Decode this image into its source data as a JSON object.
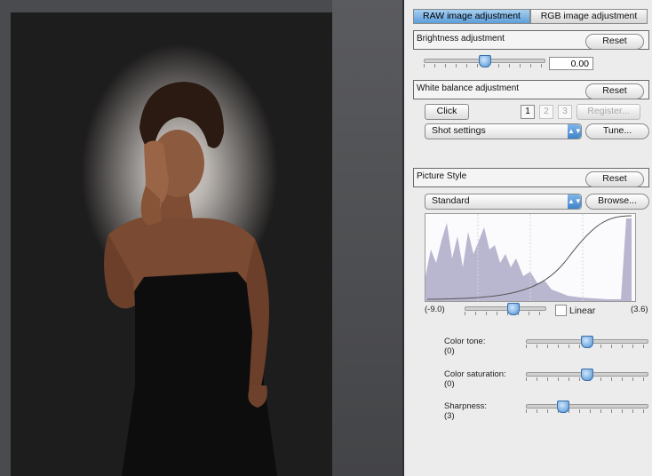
{
  "tabs": [
    {
      "label": "RAW image adjustment",
      "active": true
    },
    {
      "label": "RGB image adjustment",
      "active": false
    }
  ],
  "brightness": {
    "title": "Brightness adjustment",
    "reset_label": "Reset",
    "value": "0.00",
    "slider_level": 0.5
  },
  "white_balance": {
    "title": "White balance adjustment",
    "reset_label": "Reset",
    "click_label": "Click",
    "presets": [
      "1",
      "2",
      "3"
    ],
    "register_label": "Register...",
    "select_value": "Shot settings",
    "tune_label": "Tune..."
  },
  "picture_style": {
    "title": "Picture Style",
    "reset_label": "Reset",
    "select_value": "Standard",
    "browse_label": "Browse...",
    "range_min": "(-9.0)",
    "range_max": "(3.6)",
    "linear_label": "Linear",
    "linear_checked": false,
    "curve_slider_level": 0.6,
    "params": [
      {
        "label": "Color tone:",
        "value": "(0)",
        "level": 0.5
      },
      {
        "label": "Color saturation:",
        "value": "(0)",
        "level": 0.5
      },
      {
        "label": "Sharpness:",
        "value": "(3)",
        "level": 0.3
      }
    ]
  },
  "colors": {
    "tab_active": "#5d9fdb",
    "histogram_fill": "#b9b6cf",
    "panel_bg": "#ececec"
  }
}
